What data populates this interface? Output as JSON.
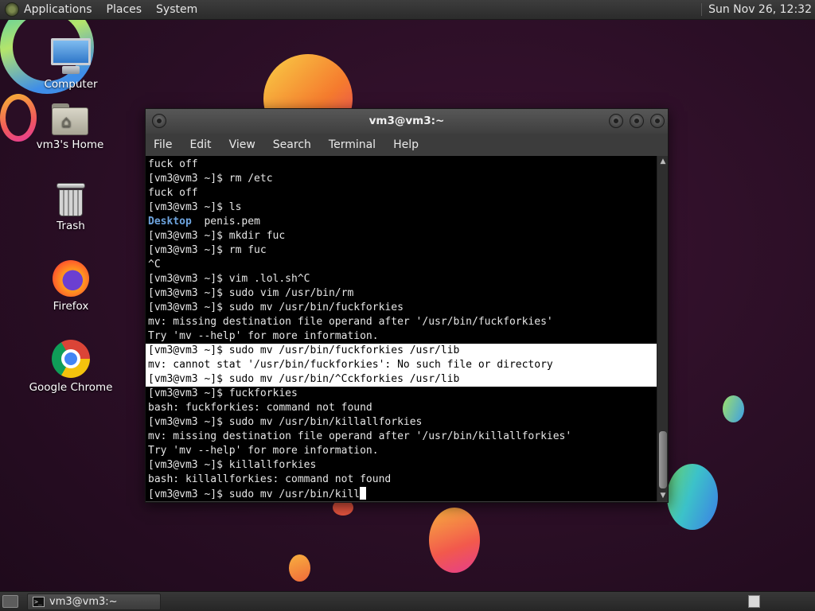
{
  "top_panel": {
    "menus": [
      "Applications",
      "Places",
      "System"
    ],
    "clock": "Sun Nov 26, 12:32"
  },
  "desktop_icons": [
    {
      "label": "Computer",
      "icon": "computer-icon"
    },
    {
      "label": "vm3's Home",
      "icon": "home-folder-icon"
    },
    {
      "label": "Trash",
      "icon": "trash-icon"
    },
    {
      "label": "Firefox",
      "icon": "firefox-icon"
    },
    {
      "label": "Google Chrome",
      "icon": "chrome-icon"
    }
  ],
  "window": {
    "title": "vm3@vm3:~",
    "menus": [
      "File",
      "Edit",
      "View",
      "Search",
      "Terminal",
      "Help"
    ]
  },
  "terminal": {
    "lines": [
      "fuck off",
      "[vm3@vm3 ~]$ rm /etc",
      "fuck off",
      "[vm3@vm3 ~]$ ls",
      "Desktop  penis.pem",
      "[vm3@vm3 ~]$ mkdir fuc",
      "[vm3@vm3 ~]$ rm fuc",
      "^C",
      "[vm3@vm3 ~]$ vim .lol.sh^C",
      "[vm3@vm3 ~]$ sudo vim /usr/bin/rm",
      "[vm3@vm3 ~]$ sudo mv /usr/bin/fuckforkies",
      "mv: missing destination file operand after '/usr/bin/fuckforkies'",
      "Try 'mv --help' for more information.",
      "[vm3@vm3 ~]$ sudo mv /usr/bin/fuckforkies /usr/lib",
      "mv: cannot stat '/usr/bin/fuckforkies': No such file or directory",
      "[vm3@vm3 ~]$ sudo mv /usr/bin/^Cckforkies /usr/lib",
      "[vm3@vm3 ~]$ fuckforkies",
      "bash: fuckforkies: command not found",
      "[vm3@vm3 ~]$ sudo mv /usr/bin/killallforkies",
      "mv: missing destination file operand after '/usr/bin/killallforkies'",
      "Try 'mv --help' for more information.",
      "[vm3@vm3 ~]$ killallforkies",
      "bash: killallforkies: command not found",
      "[vm3@vm3 ~]$ sudo mv /usr/bin/kill"
    ],
    "ls_dir": "Desktop",
    "ls_file": "  penis.pem"
  },
  "taskbar": {
    "task_label": "vm3@vm3:~"
  },
  "colors": {
    "terminal_bg": "#000000",
    "terminal_fg": "#e6e6e6",
    "directory_blue": "#6ea4de",
    "selection_bg": "#ffffff"
  }
}
